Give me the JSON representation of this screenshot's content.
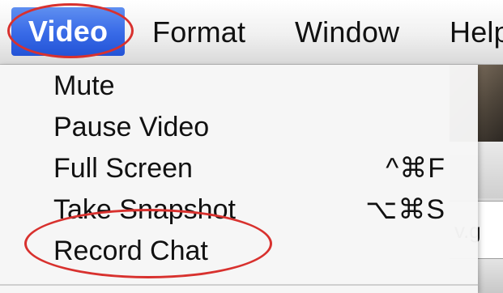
{
  "menubar": {
    "items": [
      {
        "label": "Video",
        "active": true
      },
      {
        "label": "Format"
      },
      {
        "label": "Window"
      },
      {
        "label": "Help"
      }
    ]
  },
  "video_menu": {
    "items": [
      {
        "label": "Mute",
        "shortcut": ""
      },
      {
        "label": "Pause Video",
        "shortcut": ""
      },
      {
        "label": "Full Screen",
        "shortcut": "^⌘F"
      },
      {
        "label": "Take Snapshot",
        "shortcut": "⌥⌘S"
      },
      {
        "label": "Record Chat",
        "shortcut": ""
      }
    ]
  },
  "background_window": {
    "url_fragment": "v.g"
  },
  "colors": {
    "menu_highlight": "#3a6ce8",
    "annotation": "#d8312e"
  }
}
